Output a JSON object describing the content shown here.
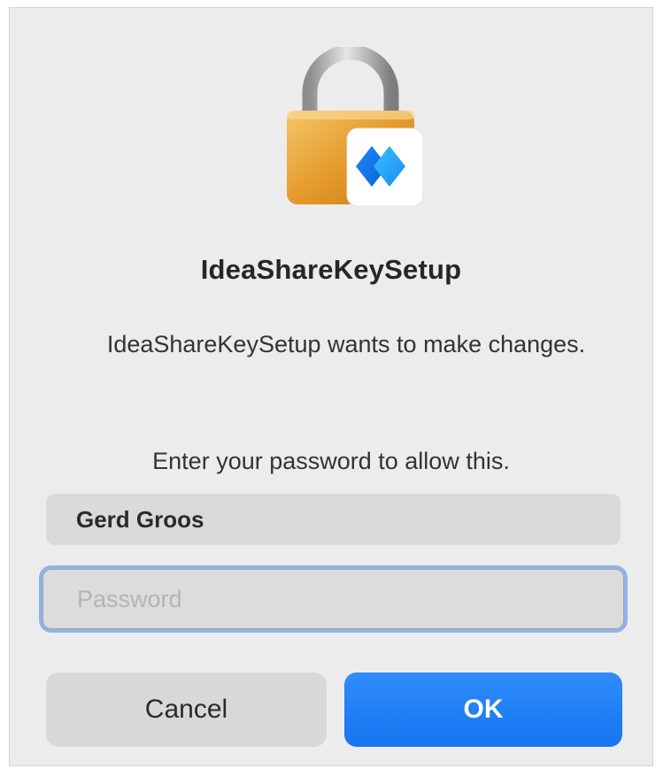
{
  "dialog": {
    "app_icon": "lock-icon",
    "badge_icon": "ideashare-diamond-icon",
    "title": "IdeaShareKeySetup",
    "message": "IdeaShareKeySetup wants to make changes.",
    "prompt": "Enter your password to allow this."
  },
  "form": {
    "username_value": "Gerd Groos",
    "password_placeholder": "Password",
    "password_value": ""
  },
  "buttons": {
    "cancel_label": "Cancel",
    "ok_label": "OK"
  },
  "colors": {
    "accent": "#1a7cf5",
    "focus_ring": "#8eb2ea",
    "dialog_background": "#ececec"
  }
}
